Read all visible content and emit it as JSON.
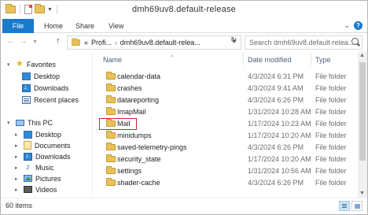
{
  "window": {
    "title": "dmh69uv8.default-release"
  },
  "ribbon": {
    "tabs": [
      "File",
      "Home",
      "Share",
      "View"
    ]
  },
  "navbar": {
    "breadcrumb": [
      "«",
      "Profi...",
      "dmh69uv8.default-releа..."
    ],
    "search_placeholder": "Search dmh69uv8.default-releа..."
  },
  "navpane": {
    "favorites_label": "Favorites",
    "favorites": [
      "Desktop",
      "Downloads",
      "Recent places"
    ],
    "thispc_label": "This PC",
    "thispc": [
      "Desktop",
      "Documents",
      "Downloads",
      "Music",
      "Pictures",
      "Videos"
    ]
  },
  "columns": {
    "name": "Name",
    "date": "Date modified",
    "type": "Type"
  },
  "files": [
    {
      "name": "calendar-data",
      "date": "4/3/2024 6:31 PM",
      "type": "File folder"
    },
    {
      "name": "crashes",
      "date": "4/3/2024 9:41 AM",
      "type": "File folder"
    },
    {
      "name": "datareporting",
      "date": "4/3/2024 6:26 PM",
      "type": "File folder"
    },
    {
      "name": "ImapMail",
      "date": "1/31/2024 10:28 AM",
      "type": "File folder"
    },
    {
      "name": "Mail",
      "date": "1/17/2024 10:23 AM",
      "type": "File folder"
    },
    {
      "name": "minidumps",
      "date": "1/17/2024 10:20 AM",
      "type": "File folder"
    },
    {
      "name": "saved-telemetry-pings",
      "date": "4/3/2024 6:26 PM",
      "type": "File folder"
    },
    {
      "name": "security_state",
      "date": "1/17/2024 10:20 AM",
      "type": "File folder"
    },
    {
      "name": "settings",
      "date": "1/31/2024 10:56 AM",
      "type": "File folder"
    },
    {
      "name": "shader-cache",
      "date": "4/3/2024 6:26 PM",
      "type": "File folder"
    }
  ],
  "highlighted_file": "Mail",
  "status": {
    "items": "60 items"
  },
  "colors": {
    "file_tab": "#1979ca",
    "highlight_box": "#c8262c",
    "folder": "#e8c15b"
  }
}
